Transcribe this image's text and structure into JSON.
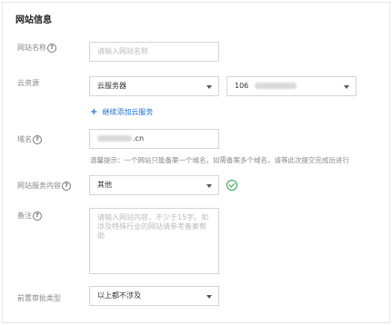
{
  "section_title": "网站信息",
  "fields": {
    "site_name": {
      "label": "网站名称",
      "placeholder": "请输入网站名称"
    },
    "cloud_resource": {
      "label": "云资源",
      "type_value": "云服务器",
      "ip_value": "106",
      "add_link": "继续添加云服务"
    },
    "domain": {
      "label": "域名",
      "value_suffix": ".cn"
    },
    "hint": "温馨提示：一个网站只能备案一个域名，如需备案多个域名，请等此次提交完成后进行",
    "service_content": {
      "label": "网站服务内容",
      "value": "其他"
    },
    "remarks": {
      "label": "备注",
      "placeholder": "请输入网站内容，不少于15字。如涉及特殊行业的网站请参考备案帮助"
    },
    "pre_approval": {
      "label": "前置审批类型",
      "value": "以上都不涉及"
    }
  },
  "icons": {
    "help": "?",
    "plus": "+"
  },
  "colors": {
    "link": "#1a6fd6",
    "success": "#2ba34a",
    "label": "#888888"
  }
}
